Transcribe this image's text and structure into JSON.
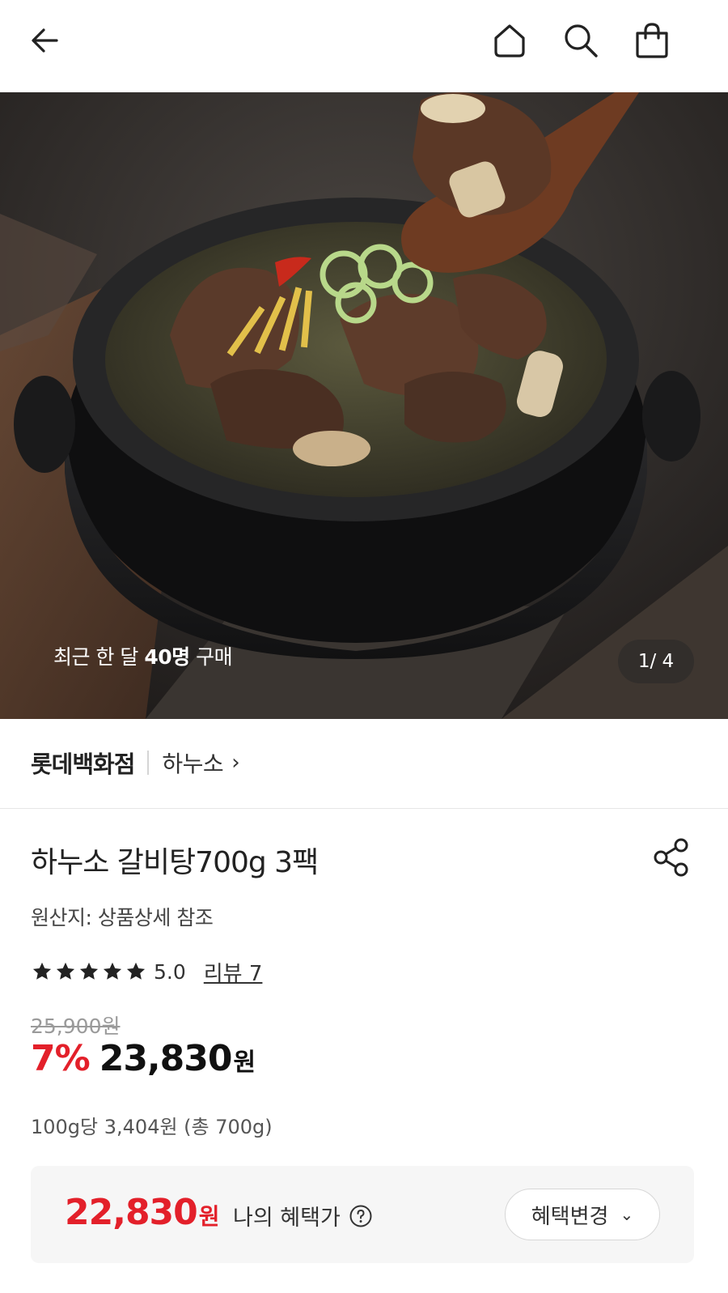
{
  "header": {
    "back_icon": "arrow-left-icon",
    "home_icon": "home-icon",
    "search_icon": "search-icon",
    "cart_icon": "shopping-bag-icon"
  },
  "gallery": {
    "purchase_prefix": "최근 한 달 ",
    "purchase_count": "40명",
    "purchase_suffix": " 구매",
    "pager": "1/ 4"
  },
  "store": {
    "name": "롯데백화점",
    "brand": "하누소",
    "chevron": "›"
  },
  "product": {
    "title": "하누소 갈비탕700g 3팩",
    "origin": "원산지: 상품상세 참조",
    "rating_stars": 5,
    "rating_score": "5.0",
    "review_label": "리뷰 7",
    "original_price": "25,900원",
    "discount": "7%",
    "price": "23,830",
    "price_unit": "원",
    "unit_price": "100g당 3,404원 (총 700g)"
  },
  "benefit": {
    "price": "22,830",
    "price_unit": "원",
    "label": "나의 혜택가",
    "change_label": "혜택변경",
    "accent_color": "#e3202a"
  }
}
